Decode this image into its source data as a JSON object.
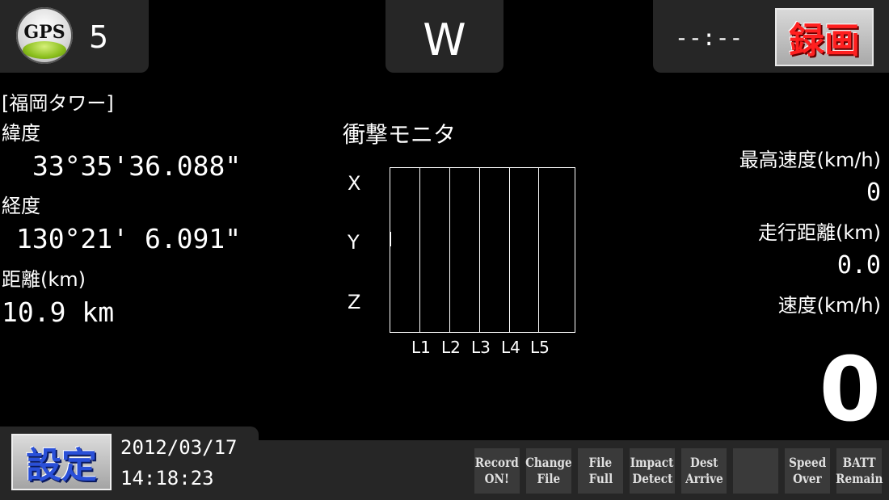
{
  "top": {
    "gps_label": "GPS",
    "satellites": "5",
    "heading": "W",
    "clock": "--:--",
    "record_button": "録画"
  },
  "location": {
    "name": "[福岡タワー]",
    "lat_label": "緯度",
    "lat_value": "33°35'36.088\"",
    "lon_label": "経度",
    "lon_value": "130°21' 6.091\"",
    "dist_label": "距離(km)",
    "dist_value": "10.9 km"
  },
  "impact_monitor": {
    "title": "衝撃モニタ",
    "axes": [
      "X",
      "Y",
      "Z"
    ],
    "levels": [
      "L1",
      "L2",
      "L3",
      "L4",
      "L5"
    ]
  },
  "stats": {
    "max_speed_label": "最高速度(km/h)",
    "max_speed_value": "0",
    "distance_label": "走行距離(km)",
    "distance_value": "0.0",
    "speed_label": "速度(km/h)",
    "speed_value": "0"
  },
  "footer": {
    "settings_button": "設定",
    "date": "2012/03/17",
    "time": "14:18:23",
    "indicators": [
      {
        "line1": "Record",
        "line2": "ON!"
      },
      {
        "line1": "Change",
        "line2": "File"
      },
      {
        "line1": "File",
        "line2": "Full"
      },
      {
        "line1": "Impact",
        "line2": "Detect"
      },
      {
        "line1": "Dest",
        "line2": "Arrive"
      },
      {
        "line1": "",
        "line2": ""
      },
      {
        "line1": "Speed",
        "line2": "Over"
      },
      {
        "line1": "BATT",
        "line2": "Remain"
      }
    ]
  },
  "colors": {
    "background": "#000000",
    "panel": "#262626",
    "record_text": "#ff2020",
    "settings_text": "#2a50d8",
    "gps_green": "#8bbf1d"
  }
}
